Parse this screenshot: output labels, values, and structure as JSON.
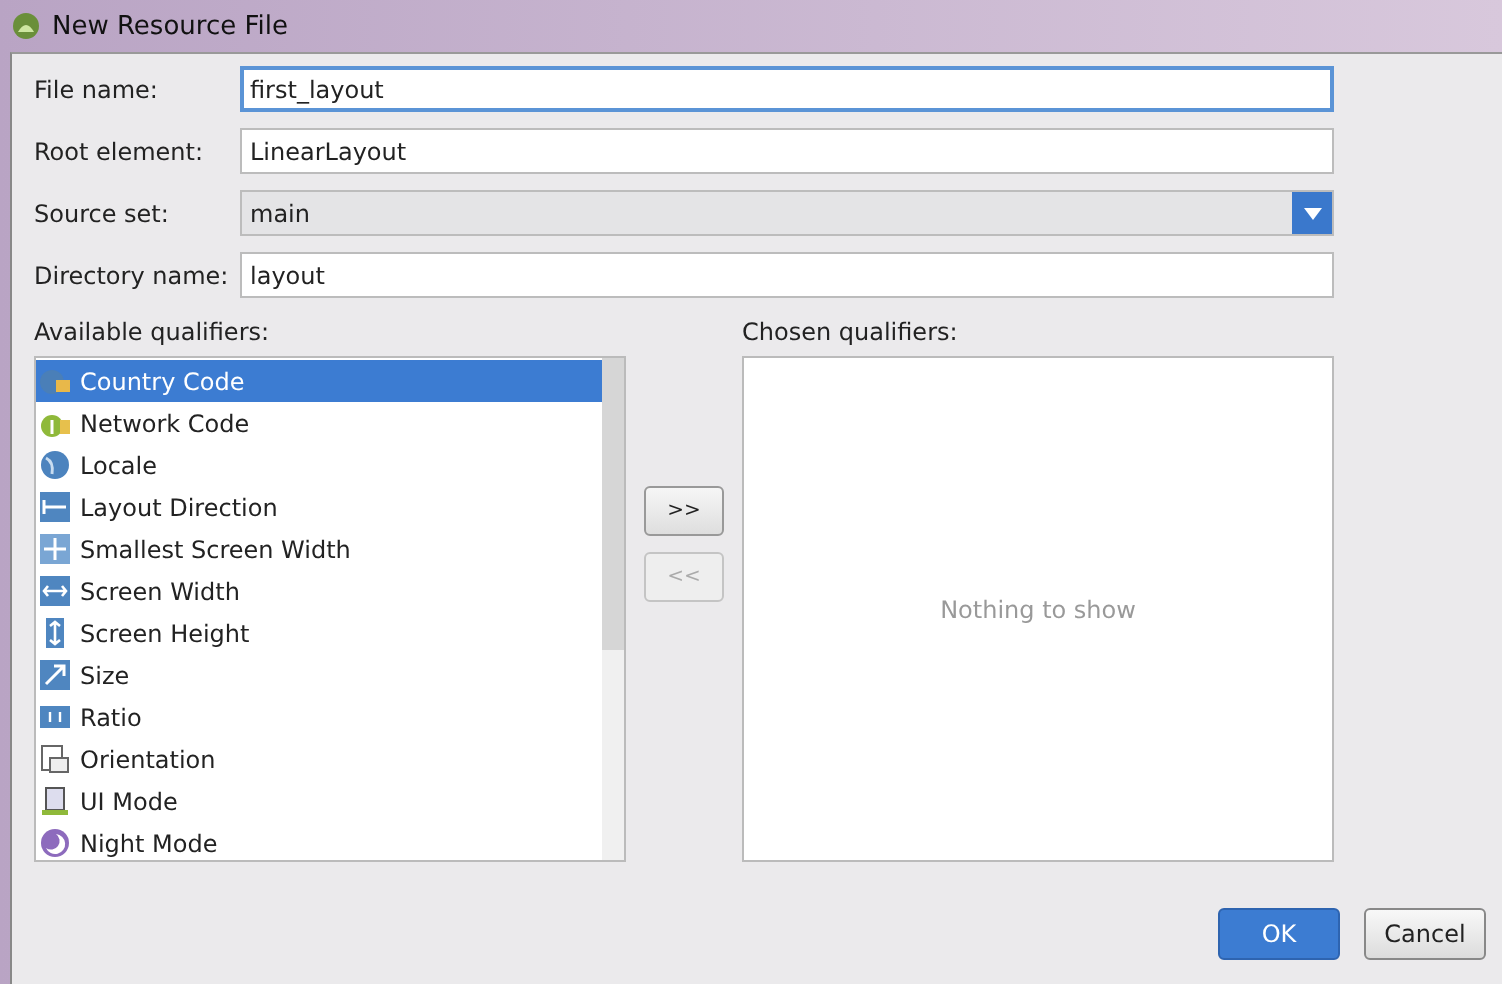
{
  "window": {
    "title": "New Resource File"
  },
  "fields": [
    {
      "kind": "text",
      "label": "File name:",
      "value": "first_layout",
      "focused": true
    },
    {
      "kind": "text",
      "label": "Root element:",
      "value": "LinearLayout",
      "focused": false
    },
    {
      "kind": "dropdown",
      "label": "Source set:",
      "value": "main"
    },
    {
      "kind": "text",
      "label": "Directory name:",
      "value": "layout",
      "focused": false
    }
  ],
  "available": {
    "label": "Available qualifiers:",
    "items": [
      {
        "label": "Country Code",
        "kind": "country",
        "selected": true
      },
      {
        "label": "Network Code",
        "kind": "network",
        "selected": false
      },
      {
        "label": "Locale",
        "kind": "locale",
        "selected": false
      },
      {
        "label": "Layout Direction",
        "kind": "direction",
        "selected": false
      },
      {
        "label": "Smallest Screen Width",
        "kind": "smallest",
        "selected": false
      },
      {
        "label": "Screen Width",
        "kind": "width",
        "selected": false
      },
      {
        "label": "Screen Height",
        "kind": "height",
        "selected": false
      },
      {
        "label": "Size",
        "kind": "size",
        "selected": false
      },
      {
        "label": "Ratio",
        "kind": "ratio",
        "selected": false
      },
      {
        "label": "Orientation",
        "kind": "orientation",
        "selected": false
      },
      {
        "label": "UI Mode",
        "kind": "uimode",
        "selected": false
      },
      {
        "label": "Night Mode",
        "kind": "night",
        "selected": false
      }
    ]
  },
  "move_buttons": [
    {
      "label": ">>",
      "disabled": false
    },
    {
      "label": "<<",
      "disabled": true
    }
  ],
  "chosen": {
    "label": "Chosen qualifiers:",
    "empty_text": "Nothing to show"
  },
  "buttons": [
    {
      "label": "OK",
      "default": true
    },
    {
      "label": "Cancel",
      "default": false
    }
  ]
}
